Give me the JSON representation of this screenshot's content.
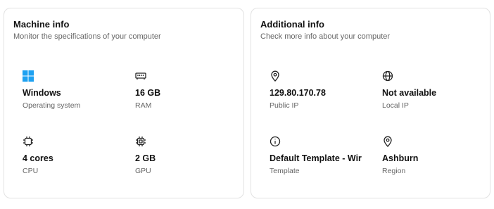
{
  "machine_info": {
    "title": "Machine info",
    "subtitle": "Monitor the specifications of your computer",
    "items": [
      {
        "icon": "windows-logo-icon",
        "value": "Windows",
        "label": "Operating system"
      },
      {
        "icon": "ram-icon",
        "value": "16 GB",
        "label": "RAM"
      },
      {
        "icon": "cpu-icon",
        "value": "4 cores",
        "label": "CPU"
      },
      {
        "icon": "gpu-icon",
        "value": "2 GB",
        "label": "GPU"
      }
    ]
  },
  "additional_info": {
    "title": "Additional info",
    "subtitle": "Check more info about your computer",
    "items": [
      {
        "icon": "location-pin-icon",
        "value": "129.80.170.78",
        "label": "Public IP"
      },
      {
        "icon": "globe-icon",
        "value": "Not available",
        "label": "Local IP"
      },
      {
        "icon": "info-circle-icon",
        "value": "Default Template - Wir",
        "label": "Template"
      },
      {
        "icon": "location-pin-icon",
        "value": "Ashburn",
        "label": "Region"
      }
    ]
  },
  "colors": {
    "windows_blue": "#1ea1f1",
    "border": "#e2e2e2",
    "muted_text": "#666666"
  }
}
